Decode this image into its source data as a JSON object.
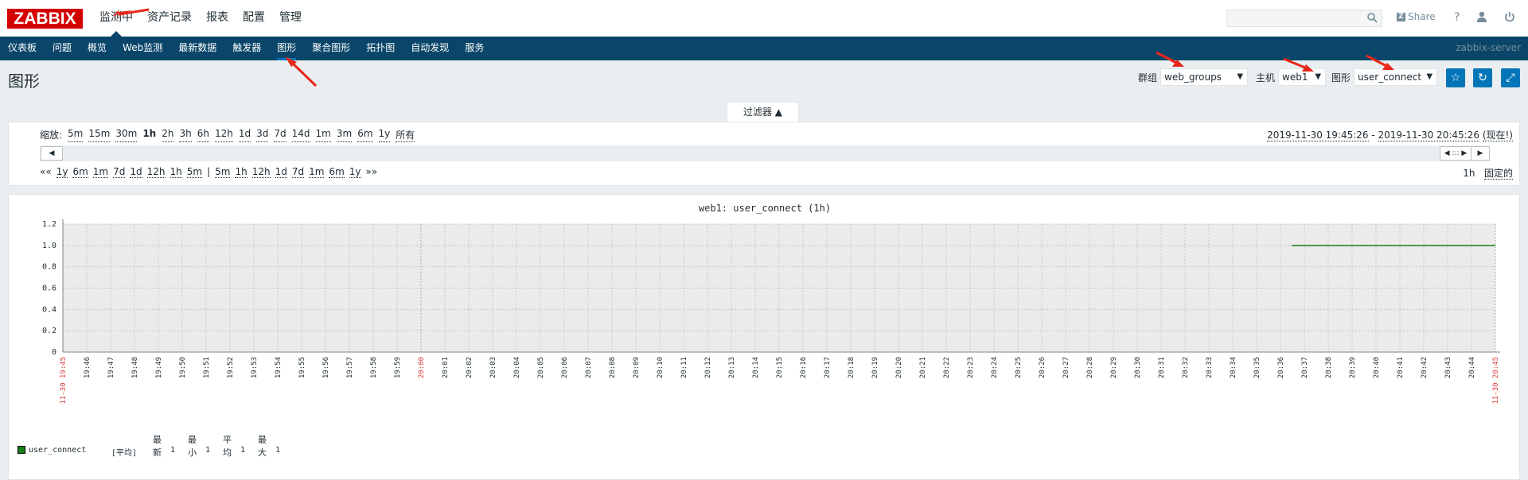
{
  "logo": "ZABBIX",
  "top_nav": [
    "监测中",
    "资产记录",
    "报表",
    "配置",
    "管理"
  ],
  "top_right": {
    "share": "Share",
    "help_icon": "question-icon",
    "user_icon": "user-icon",
    "logout_icon": "power-icon"
  },
  "sub_nav": [
    "仪表板",
    "问题",
    "概览",
    "Web监测",
    "最新数据",
    "触发器",
    "图形",
    "聚合图形",
    "拓扑图",
    "自动发现",
    "服务"
  ],
  "server_name": "zabbix-server",
  "page_title": "图形",
  "filters": {
    "group_label": "群组",
    "group_value": "web_groups",
    "host_label": "主机",
    "host_value": "web1",
    "graph_label": "图形",
    "graph_value": "user_connect"
  },
  "filter_tab_label": "过滤器 ▲",
  "zoom_label": "缩放:",
  "zoom_options": [
    "5m",
    "15m",
    "30m",
    "1h",
    "2h",
    "3h",
    "6h",
    "12h",
    "1d",
    "3d",
    "7d",
    "14d",
    "1m",
    "3m",
    "6m",
    "1y",
    "所有"
  ],
  "zoom_active": "1h",
  "date_from": "2019-11-30 19:45:26",
  "date_sep": " - ",
  "date_to": "2019-11-30 20:45:26",
  "date_now": "(现在!)",
  "nav_left": [
    "««",
    "1y",
    "6m",
    "1m",
    "7d",
    "1d",
    "12h",
    "1h",
    "5m",
    "|",
    "5m",
    "1h",
    "12h",
    "1d",
    "7d",
    "1m",
    "6m",
    "1y",
    "»»"
  ],
  "period_label": "1h",
  "fixed_label": "固定的",
  "graph": {
    "title": "web1: user_connect (1h)",
    "legend_headers": [
      "最新",
      "最小",
      "平均",
      "最大"
    ],
    "legend_item": "user_connect",
    "legend_func": "[平均]",
    "legend_values": [
      "1",
      "1",
      "1",
      "1"
    ]
  },
  "chart_data": {
    "type": "line",
    "title": "web1: user_connect (1h)",
    "ylim": [
      0,
      1.2
    ],
    "yticks": [
      "0",
      "0.2",
      "0.4",
      "0.6",
      "0.8",
      "1.0",
      "1.2"
    ],
    "xticks": [
      "11-30 19:45",
      "19:46",
      "19:47",
      "19:48",
      "19:49",
      "19:50",
      "19:51",
      "19:52",
      "19:53",
      "19:54",
      "19:55",
      "19:56",
      "19:57",
      "19:58",
      "19:59",
      "20:00",
      "20:01",
      "20:02",
      "20:03",
      "20:04",
      "20:05",
      "20:06",
      "20:07",
      "20:08",
      "20:09",
      "20:10",
      "20:11",
      "20:12",
      "20:13",
      "20:14",
      "20:15",
      "20:16",
      "20:17",
      "20:18",
      "20:19",
      "20:20",
      "20:21",
      "20:22",
      "20:23",
      "20:24",
      "20:25",
      "20:26",
      "20:27",
      "20:28",
      "20:29",
      "20:30",
      "20:31",
      "20:32",
      "20:33",
      "20:34",
      "20:35",
      "20:36",
      "20:37",
      "20:38",
      "20:39",
      "20:40",
      "20:41",
      "20:42",
      "20:43",
      "20:44",
      "11-30 20:45"
    ],
    "xticks_red": [
      "11-30 19:45",
      "20:00",
      "11-30 20:45"
    ],
    "series": [
      {
        "name": "user_connect",
        "color": "#1a7f1a",
        "x": [
          "20:36:54",
          "20:45:26"
        ],
        "values": [
          1,
          1
        ]
      }
    ],
    "grid": true
  }
}
